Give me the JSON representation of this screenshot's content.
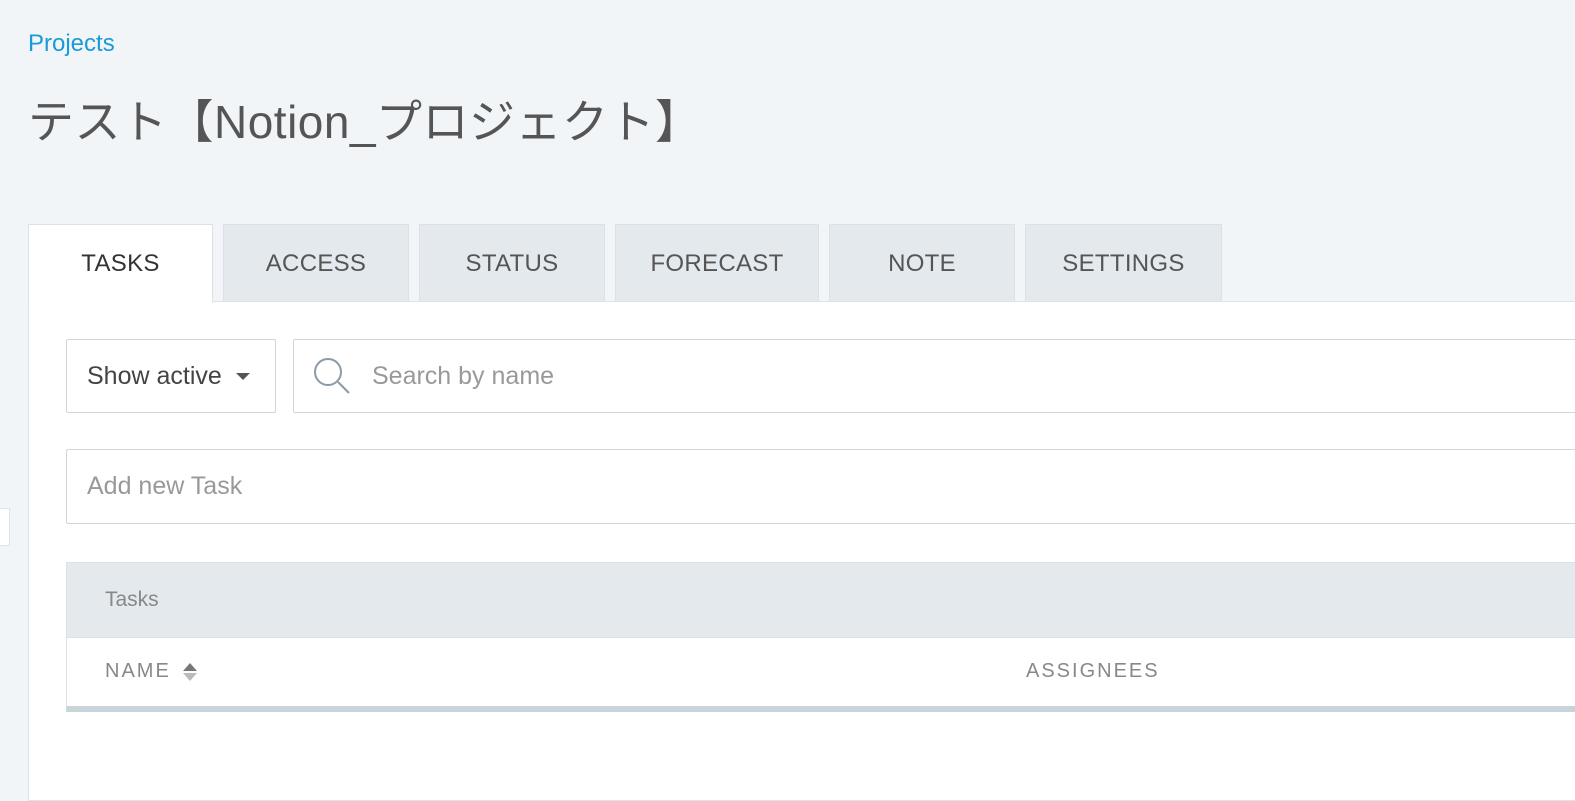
{
  "breadcrumb": {
    "label": "Projects"
  },
  "page": {
    "title": "テスト【Notion_プロジェクト】"
  },
  "tabs": [
    {
      "label": "TASKS",
      "active": true
    },
    {
      "label": "ACCESS",
      "active": false
    },
    {
      "label": "STATUS",
      "active": false
    },
    {
      "label": "FORECAST",
      "active": false
    },
    {
      "label": "NOTE",
      "active": false
    },
    {
      "label": "SETTINGS",
      "active": false
    }
  ],
  "filters": {
    "status_select": {
      "value": "Show active"
    },
    "search": {
      "placeholder": "Search by name",
      "value": "",
      "icon": "search-icon"
    }
  },
  "new_task": {
    "placeholder": "Add new Task",
    "value": ""
  },
  "table": {
    "caption": "Tasks",
    "columns": [
      {
        "label": "NAME",
        "sortable": true
      },
      {
        "label": "ASSIGNEES",
        "sortable": false
      }
    ],
    "rows": []
  },
  "colors": {
    "link": "#1a9bd7",
    "background": "#f1f5f8",
    "tab_inactive": "#e4e9ed"
  }
}
